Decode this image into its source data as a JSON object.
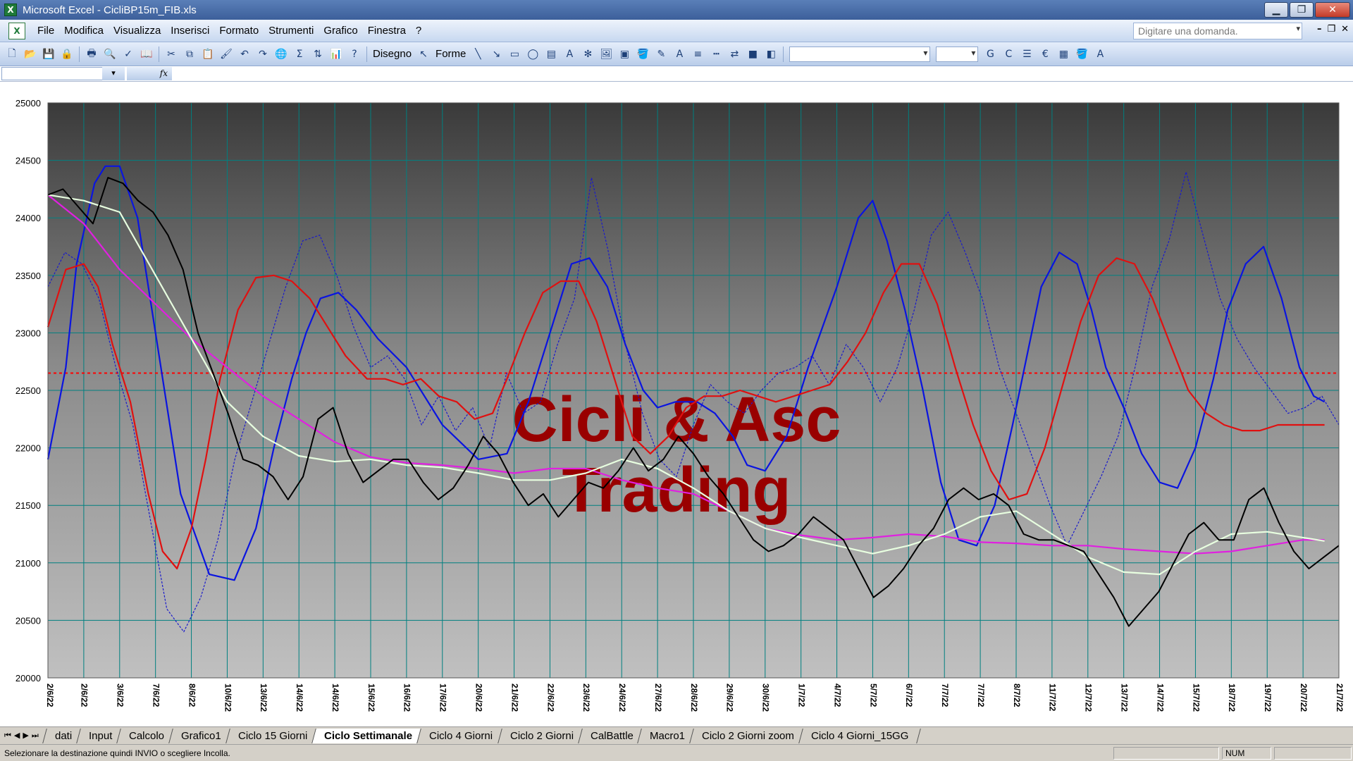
{
  "window": {
    "title": "Microsoft Excel - CicliBP15m_FIB.xls",
    "min_label": "▁",
    "max_label": "❐",
    "close_label": "✕"
  },
  "menu": {
    "items": [
      "File",
      "Modifica",
      "Visualizza",
      "Inserisci",
      "Formato",
      "Strumenti",
      "Grafico",
      "Finestra",
      "?"
    ],
    "ask_placeholder": "Digitare una domanda."
  },
  "toolbar": {
    "disegno_label": "Disegno",
    "forme_label": "Forme",
    "bold_label": "G",
    "italic_label": "C"
  },
  "chart_data": {
    "type": "line",
    "watermark": [
      "Cicli & Asc",
      "Trading"
    ],
    "ylim": [
      20000,
      25000
    ],
    "yticks": [
      "25000",
      "24500",
      "24000",
      "23500",
      "23000",
      "22500",
      "22000",
      "21500",
      "21000",
      "20500",
      "20000"
    ],
    "x_categories": [
      "2/6/22",
      "3/6/22",
      "7/6/22",
      "8/6/22",
      "10/6/22",
      "13/6/22",
      "14/6/22",
      "14/6/22",
      "15/6/22",
      "16/6/22",
      "17/6/22",
      "20/6/22",
      "21/6/22",
      "22/6/22",
      "23/6/22",
      "24/6/22",
      "27/6/22",
      "28/6/22",
      "29/6/22",
      "30/6/22",
      "1/7/22",
      "4/7/22",
      "5/7/22",
      "6/7/22",
      "7/7/22",
      "7/7/22",
      "8/7/22",
      "11/7/22",
      "12/7/22",
      "13/7/22",
      "14/7/22",
      "15/7/22",
      "18/7/22",
      "19/7/22",
      "20/7/22",
      "21/7/22"
    ],
    "reference_line": 22650,
    "colors": {
      "price": "#000000",
      "oscillator": "#1a1acc",
      "cycle_blue": "#0a14e0",
      "cycle_red": "#e01010",
      "ma_magenta": "#e020e0",
      "ma_light": "#e8ffe0",
      "reference": "#ff0000",
      "watermark": "#990000",
      "grid": "#008080"
    },
    "series": [
      {
        "name": "",
        "role": "price",
        "values": [
          24200,
          24250,
          24100,
          23950,
          24350,
          24300,
          24150,
          24050,
          23850,
          23550,
          23000,
          22650,
          22300,
          21900,
          21850,
          21750,
          21550,
          21750,
          22250,
          22350,
          21950,
          21700,
          21800,
          21900,
          21900,
          21700,
          21550,
          21650,
          21850,
          22100,
          21950,
          21700,
          21500,
          21600,
          21400,
          21550,
          21700,
          21650,
          21800,
          22000,
          21800,
          21900,
          22100,
          21950,
          21750,
          21600,
          21400,
          21200,
          21100,
          21150,
          21250,
          21400,
          21300,
          21200,
          20950,
          20700,
          20800,
          20950,
          21150,
          21300,
          21550,
          21650,
          21550,
          21600,
          21500,
          21250,
          21200,
          21200,
          21150,
          21100,
          20900,
          20700,
          20450,
          20600,
          20750,
          21000,
          21250,
          21350,
          21200,
          21200,
          21550,
          21650,
          21350,
          21100,
          20950,
          21050,
          21150
        ]
      },
      {
        "name": "",
        "role": "oscillator",
        "values": [
          23400,
          23700,
          23600,
          23300,
          22700,
          22200,
          21400,
          20600,
          20400,
          20700,
          21200,
          21900,
          22400,
          22900,
          23400,
          23800,
          23850,
          23500,
          23050,
          22700,
          22800,
          22600,
          22200,
          22450,
          22150,
          22350,
          22000,
          22650,
          22300,
          22400,
          22900,
          23300,
          24350,
          23700,
          22900,
          22300,
          21900,
          21750,
          22200,
          22550,
          22400,
          22300,
          22500,
          22650,
          22700,
          22800,
          22550,
          22900,
          22700,
          22400,
          22700,
          23200,
          23850,
          24050,
          23700,
          23300,
          22700,
          22300,
          21900,
          21500,
          21150,
          21450,
          21750,
          22100,
          22700,
          23400,
          23800,
          24400,
          23850,
          23300,
          22950,
          22700,
          22500,
          22300,
          22350,
          22450,
          22200
        ]
      },
      {
        "name": "",
        "role": "cycle_blue",
        "x": [
          0,
          0.5,
          0.8,
          1.3,
          1.6,
          2.0,
          2.5,
          3.0,
          3.7,
          4.5,
          5.2,
          5.8,
          6.3,
          6.8,
          7.2,
          7.6,
          8.1,
          8.6,
          9.2,
          10.0,
          11.0,
          12.0,
          12.8,
          13.4,
          13.9,
          14.3,
          14.6,
          15.1,
          15.6,
          16.1,
          16.6,
          17.0,
          17.5,
          18.1,
          18.6,
          19.1,
          19.5,
          20.0,
          20.6,
          21.2,
          22.0,
          22.6,
          23.0,
          23.4,
          23.9,
          24.4,
          24.9,
          25.4,
          25.9,
          26.4,
          26.9,
          27.3,
          27.7,
          28.2,
          28.7,
          29.1,
          29.5,
          30.0,
          30.5,
          31.0,
          31.5,
          32.0,
          32.5,
          32.9,
          33.4,
          33.9,
          34.4,
          34.9,
          35.3,
          35.6
        ],
        "values": [
          21900,
          22700,
          23600,
          24300,
          24450,
          24450,
          24000,
          23000,
          21600,
          20900,
          20850,
          21300,
          22000,
          22600,
          23000,
          23300,
          23350,
          23200,
          22950,
          22700,
          22200,
          21900,
          21950,
          22400,
          22900,
          23300,
          23600,
          23650,
          23400,
          22900,
          22500,
          22350,
          22400,
          22400,
          22300,
          22100,
          21850,
          21800,
          22100,
          22700,
          23400,
          24000,
          24150,
          23800,
          23200,
          22500,
          21700,
          21200,
          21150,
          21500,
          22200,
          22800,
          23400,
          23700,
          23600,
          23200,
          22700,
          22350,
          21950,
          21700,
          21650,
          22000,
          22600,
          23200,
          23600,
          23750,
          23300,
          22700,
          22450,
          22400
        ]
      },
      {
        "name": "",
        "role": "cycle_red",
        "x": [
          0,
          0.5,
          1.0,
          1.4,
          1.8,
          2.3,
          2.8,
          3.2,
          3.6,
          4.0,
          4.4,
          4.8,
          5.3,
          5.8,
          6.3,
          6.8,
          7.3,
          7.8,
          8.3,
          8.9,
          9.4,
          9.9,
          10.4,
          10.9,
          11.4,
          11.9,
          12.4,
          12.8,
          13.3,
          13.8,
          14.3,
          14.8,
          15.3,
          15.8,
          16.3,
          16.8,
          17.3,
          17.8,
          18.3,
          18.8,
          19.3,
          19.8,
          20.3,
          20.8,
          21.3,
          21.8,
          22.3,
          22.8,
          23.3,
          23.8,
          24.3,
          24.8,
          25.3,
          25.8,
          26.3,
          26.8,
          27.3,
          27.8,
          28.3,
          28.8,
          29.3,
          29.8,
          30.3,
          30.8,
          31.3,
          31.8,
          32.3,
          32.8,
          33.3,
          33.8,
          34.3,
          34.8,
          35.3,
          35.6
        ],
        "values": [
          23050,
          23550,
          23600,
          23400,
          22900,
          22400,
          21600,
          21100,
          20950,
          21300,
          21900,
          22600,
          23200,
          23480,
          23500,
          23450,
          23300,
          23050,
          22800,
          22600,
          22600,
          22550,
          22600,
          22450,
          22400,
          22250,
          22300,
          22600,
          23000,
          23350,
          23450,
          23450,
          23100,
          22600,
          22100,
          21950,
          22100,
          22350,
          22450,
          22450,
          22500,
          22450,
          22400,
          22450,
          22500,
          22550,
          22750,
          23000,
          23350,
          23600,
          23600,
          23250,
          22700,
          22200,
          21800,
          21550,
          21600,
          22000,
          22550,
          23100,
          23500,
          23650,
          23600,
          23300,
          22900,
          22500,
          22300,
          22200,
          22150,
          22150,
          22200,
          22200,
          22200,
          22200
        ]
      },
      {
        "name": "",
        "role": "ma_magenta",
        "x": [
          0,
          1,
          2,
          3,
          4,
          5,
          6,
          7,
          8,
          9,
          10,
          11,
          12,
          13,
          14,
          15,
          16,
          17,
          18,
          19,
          20,
          21,
          22,
          23,
          24,
          25,
          26,
          27,
          28,
          29,
          30,
          31,
          32,
          33,
          34,
          35,
          35.6
        ],
        "values": [
          24200,
          23950,
          23550,
          23250,
          22950,
          22700,
          22450,
          22250,
          22050,
          21920,
          21870,
          21850,
          21820,
          21780,
          21820,
          21820,
          21720,
          21650,
          21600,
          21450,
          21300,
          21240,
          21200,
          21220,
          21250,
          21230,
          21180,
          21170,
          21150,
          21150,
          21120,
          21100,
          21080,
          21100,
          21150,
          21200,
          21200
        ]
      },
      {
        "name": "",
        "role": "ma_light",
        "x": [
          0,
          1,
          2,
          3,
          4,
          5,
          6,
          7,
          8,
          9,
          10,
          11,
          12,
          13,
          14,
          15,
          16,
          17,
          18,
          19,
          20,
          21,
          22,
          23,
          24,
          25,
          26,
          27,
          28,
          29,
          30,
          31,
          32,
          33,
          34,
          35,
          35.6
        ],
        "values": [
          24200,
          24150,
          24050,
          23500,
          22950,
          22400,
          22100,
          21930,
          21880,
          21900,
          21850,
          21830,
          21780,
          21720,
          21720,
          21780,
          21900,
          21820,
          21650,
          21450,
          21300,
          21220,
          21150,
          21080,
          21150,
          21250,
          21400,
          21450,
          21250,
          21050,
          20920,
          20900,
          21100,
          21250,
          21270,
          21220,
          21190
        ]
      }
    ]
  },
  "sheet_tabs": [
    "dati",
    "Input",
    "Calcolo",
    "Grafico1",
    "Ciclo 15 Giorni",
    "Ciclo Settimanale",
    "Ciclo 4 Giorni",
    "Ciclo 2 Giorni",
    "CalBattle",
    "Macro1",
    "Ciclo 2 Giorni zoom",
    "Ciclo 4 Giorni_15GG"
  ],
  "active_sheet": "Ciclo Settimanale",
  "status": {
    "message": "Selezionare la destinazione quindi INVIO o scegliere Incolla.",
    "num": "NUM"
  }
}
